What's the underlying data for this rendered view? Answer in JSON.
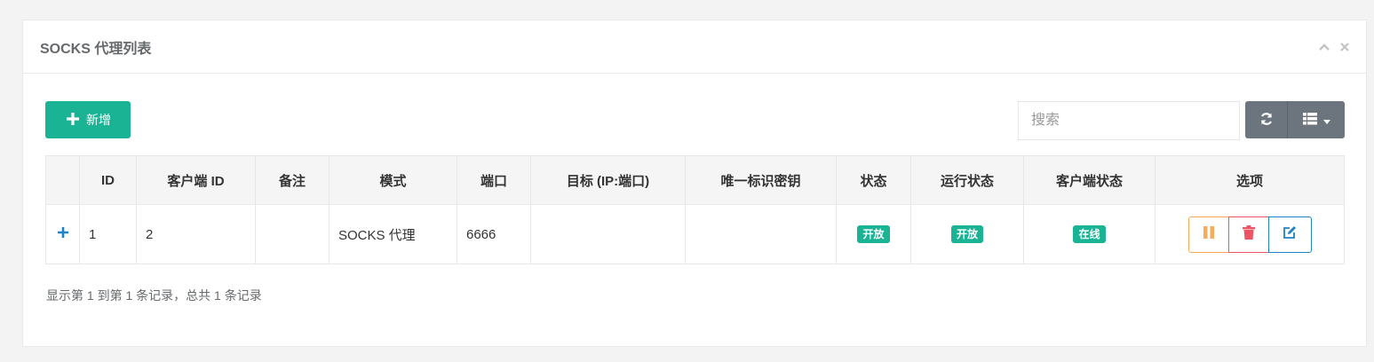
{
  "panel": {
    "title": "SOCKS 代理列表"
  },
  "toolbar": {
    "add_label": "新增",
    "search_placeholder": "搜索"
  },
  "table": {
    "headers": [
      "",
      "ID",
      "客户端 ID",
      "备注",
      "模式",
      "端口",
      "目标 (IP:端口)",
      "唯一标识密钥",
      "状态",
      "运行状态",
      "客户端状态",
      "选项"
    ],
    "rows": [
      {
        "expand": "+",
        "id": "1",
        "client_id": "2",
        "remark": "",
        "mode": "SOCKS 代理",
        "port": "6666",
        "target": "",
        "key": "",
        "status": "开放",
        "run_status": "开放",
        "client_status": "在线"
      }
    ]
  },
  "footer": {
    "summary": "显示第 1 到第 1 条记录，总共 1 条记录"
  },
  "colors": {
    "primary": "#1ab394",
    "warning": "#f8ac59",
    "danger": "#ed5565",
    "info": "#1c84c6",
    "gray": "#6c757d"
  }
}
